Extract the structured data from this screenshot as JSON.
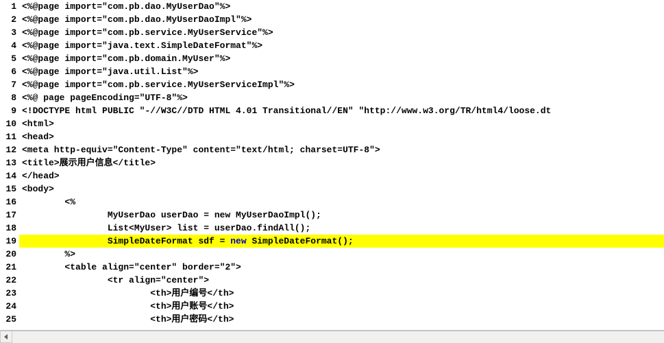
{
  "lines": [
    {
      "num": 1,
      "text": "<%@page import=\"com.pb.dao.MyUserDao\"%>",
      "hl": false
    },
    {
      "num": 2,
      "text": "<%@page import=\"com.pb.dao.MyUserDaoImpl\"%>",
      "hl": false
    },
    {
      "num": 3,
      "text": "<%@page import=\"com.pb.service.MyUserService\"%>",
      "hl": false
    },
    {
      "num": 4,
      "text": "<%@page import=\"java.text.SimpleDateFormat\"%>",
      "hl": false
    },
    {
      "num": 5,
      "text": "<%@page import=\"com.pb.domain.MyUser\"%>",
      "hl": false
    },
    {
      "num": 6,
      "text": "<%@page import=\"java.util.List\"%>",
      "hl": false
    },
    {
      "num": 7,
      "text": "<%@page import=\"com.pb.service.MyUserServiceImpl\"%>",
      "hl": false
    },
    {
      "num": 8,
      "text": "<%@ page pageEncoding=\"UTF-8\"%>",
      "hl": false
    },
    {
      "num": 9,
      "text": "<!DOCTYPE html PUBLIC \"-//W3C//DTD HTML 4.01 Transitional//EN\" \"http://www.w3.org/TR/html4/loose.dt",
      "hl": false
    },
    {
      "num": 10,
      "text": "<html>",
      "hl": false
    },
    {
      "num": 11,
      "text": "<head>",
      "hl": false
    },
    {
      "num": 12,
      "text": "<meta http-equiv=\"Content-Type\" content=\"text/html; charset=UTF-8\">",
      "hl": false
    },
    {
      "num": 13,
      "text": "<title>展示用户信息</title>",
      "hl": false
    },
    {
      "num": 14,
      "text": "</head>",
      "hl": false
    },
    {
      "num": 15,
      "text": "<body>",
      "hl": false
    },
    {
      "num": 16,
      "text": "        <%",
      "hl": false
    },
    {
      "num": 17,
      "text": "                MyUserDao userDao = new MyUserDaoImpl();",
      "hl": false
    },
    {
      "num": 18,
      "text": "                List<MyUser> list = userDao.findAll();",
      "hl": false
    },
    {
      "num": 19,
      "text": "                SimpleDateFormat sdf = ",
      "kw": "new",
      "after": " SimpleDateFormat();",
      "hl": true
    },
    {
      "num": 20,
      "text": "        %>",
      "hl": false
    },
    {
      "num": 21,
      "text": "        <table align=\"center\" border=\"2\">",
      "hl": false
    },
    {
      "num": 22,
      "text": "                <tr align=\"center\">",
      "hl": false
    },
    {
      "num": 23,
      "text": "                        <th>用户编号</th>",
      "hl": false
    },
    {
      "num": 24,
      "text": "                        <th>用户账号</th>",
      "hl": false
    },
    {
      "num": 25,
      "text": "                        <th>用户密码</th>",
      "hl": false
    }
  ]
}
